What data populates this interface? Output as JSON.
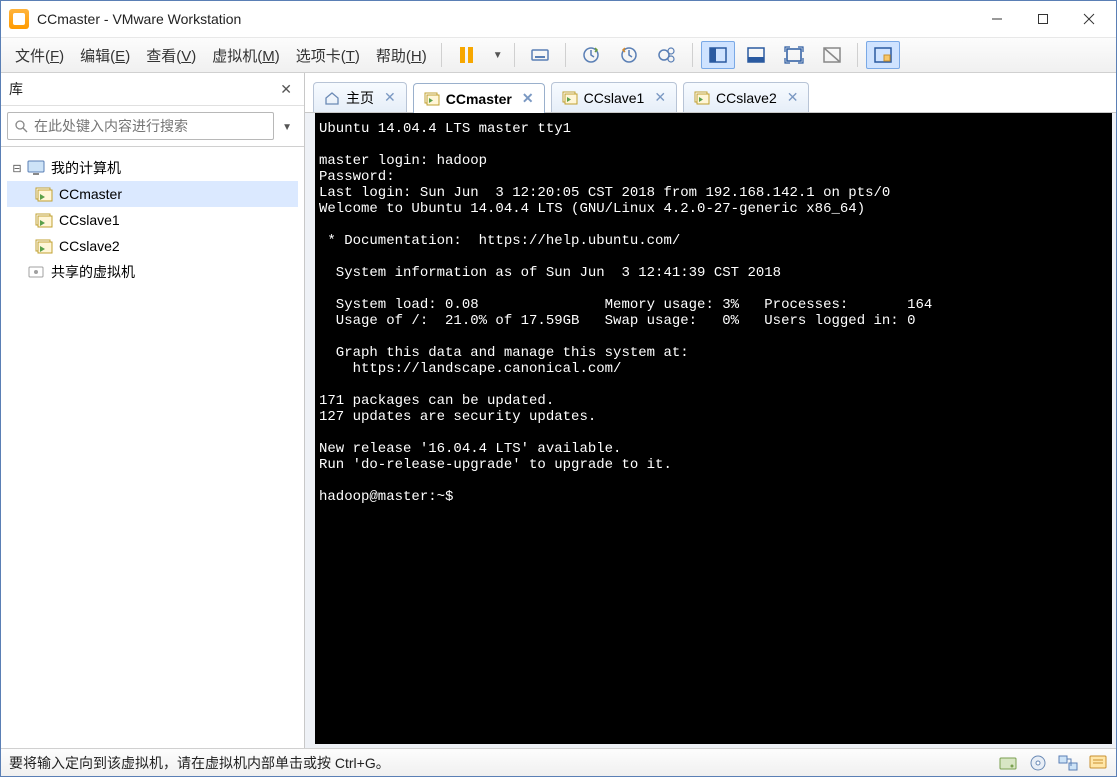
{
  "window": {
    "title": "CCmaster - VMware Workstation"
  },
  "menu": {
    "file": "文件(<u>F</u>)",
    "edit": "编辑(<u>E</u>)",
    "view": "查看(<u>V</u>)",
    "vm": "虚拟机(<u>M</u>)",
    "tabs": "选项卡(<u>T</u>)",
    "help": "帮助(<u>H</u>)"
  },
  "sidebar": {
    "title": "库",
    "search_placeholder": "在此处键入内容进行搜索",
    "root": "我的计算机",
    "nodes": [
      "CCmaster",
      "CCslave1",
      "CCslave2"
    ],
    "shared": "共享的虚拟机"
  },
  "tabs": [
    {
      "label": "主页",
      "active": false,
      "home": true
    },
    {
      "label": "CCmaster",
      "active": true
    },
    {
      "label": "CCslave1",
      "active": false
    },
    {
      "label": "CCslave2",
      "active": false
    }
  ],
  "terminal_text": "Ubuntu 14.04.4 LTS master tty1\n\nmaster login: hadoop\nPassword:\nLast login: Sun Jun  3 12:20:05 CST 2018 from 192.168.142.1 on pts/0\nWelcome to Ubuntu 14.04.4 LTS (GNU/Linux 4.2.0-27-generic x86_64)\n\n * Documentation:  https://help.ubuntu.com/\n\n  System information as of Sun Jun  3 12:41:39 CST 2018\n\n  System load: 0.08               Memory usage: 3%   Processes:       164\n  Usage of /:  21.0% of 17.59GB   Swap usage:   0%   Users logged in: 0\n\n  Graph this data and manage this system at:\n    https://landscape.canonical.com/\n\n171 packages can be updated.\n127 updates are security updates.\n\nNew release '16.04.4 LTS' available.\nRun 'do-release-upgrade' to upgrade to it.\n\nhadoop@master:~$ ",
  "status": {
    "text": "要将输入定向到该虚拟机，请在虚拟机内部单击或按 Ctrl+G。"
  }
}
